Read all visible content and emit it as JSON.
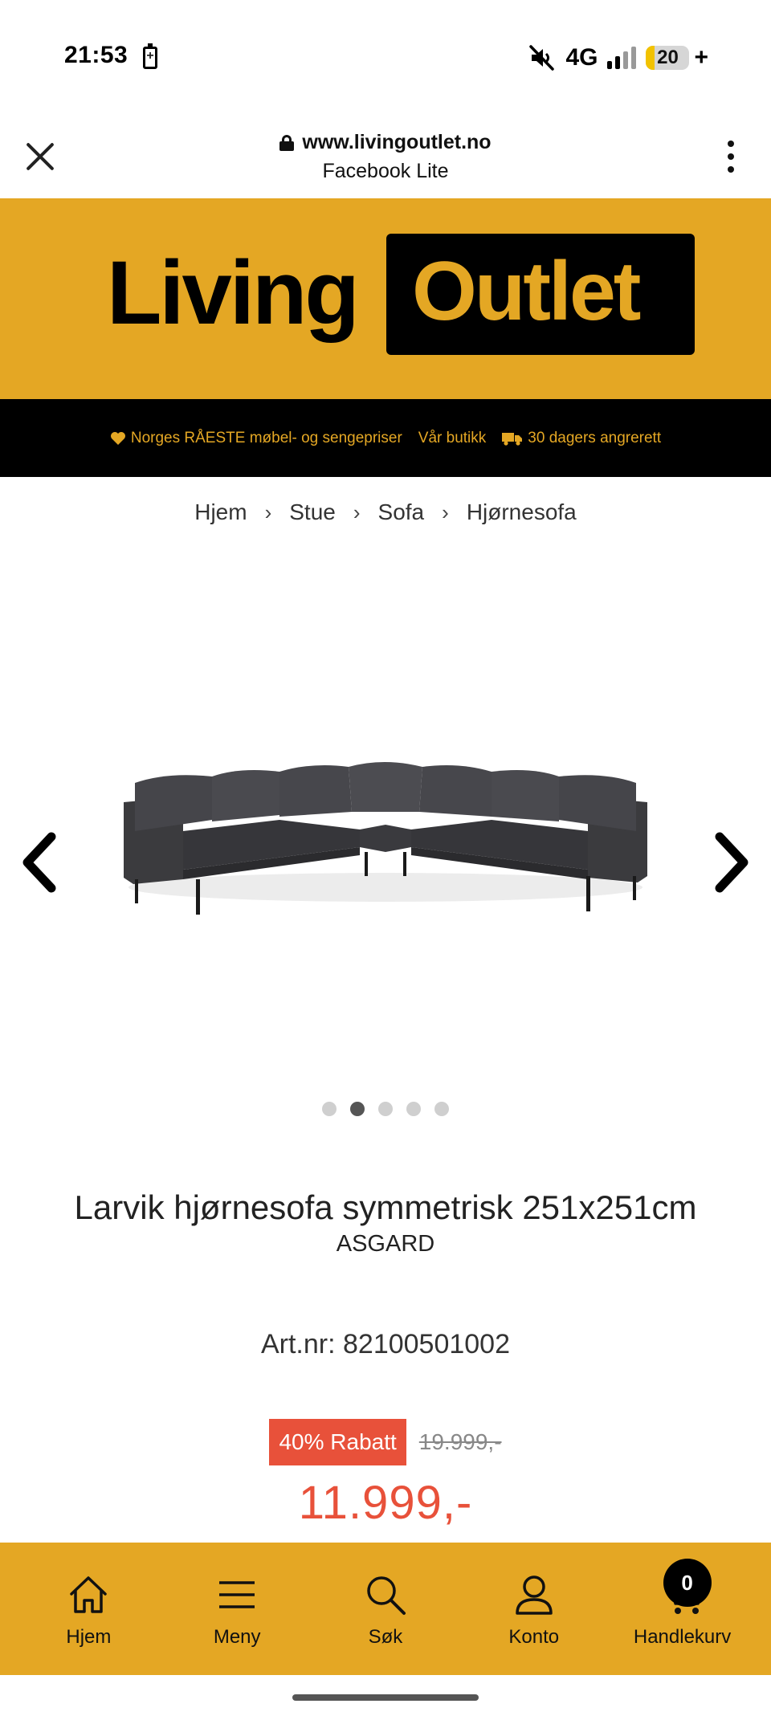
{
  "status_bar": {
    "time": "21:53",
    "network": "4G",
    "battery_level": "20",
    "battery_plus": "+",
    "battery_fraction": 0.2
  },
  "browser": {
    "url": "www.livingoutlet.no",
    "app_name": "Facebook Lite"
  },
  "logo": {
    "word1": "Living",
    "word2": "Outlet"
  },
  "usp": [
    {
      "icon": "heart-icon",
      "text": "Norges RÅESTE møbel- og sengepriser"
    },
    {
      "icon": "",
      "text": "Vår butikk"
    },
    {
      "icon": "truck-icon",
      "text": "30 dagers angrerett"
    }
  ],
  "breadcrumb": [
    "Hjem",
    "Stue",
    "Sofa",
    "Hjørnesofa"
  ],
  "gallery": {
    "image_count": 5,
    "active_index": 1
  },
  "product": {
    "title": "Larvik hjørnesofa symmetrisk 251x251cm",
    "brand": "ASGARD",
    "artnr": "Art.nr: 82100501002",
    "discount": "40% Rabatt",
    "old_price": "19.999,-",
    "new_price": "11.999,-"
  },
  "bottom_nav": [
    {
      "label": "Hjem",
      "icon": "home-icon"
    },
    {
      "label": "Meny",
      "icon": "menu-icon"
    },
    {
      "label": "Søk",
      "icon": "search-icon"
    },
    {
      "label": "Konto",
      "icon": "account-icon"
    },
    {
      "label": "Handlekurv",
      "icon": "cart-icon"
    }
  ],
  "cart_count": "0",
  "colors": {
    "brand_yellow": "#e4a724",
    "price_red": "#e8513a",
    "black": "#000000"
  }
}
